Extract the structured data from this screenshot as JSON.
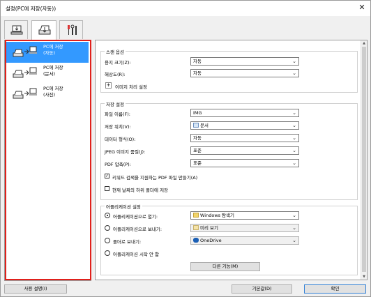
{
  "window": {
    "title": "설정(PC에 저장(자동))",
    "close": "✕"
  },
  "tabs": [
    {
      "name": "scan-tab"
    },
    {
      "name": "save-tab"
    },
    {
      "name": "tools-tab"
    }
  ],
  "left": {
    "items": [
      {
        "label1": "PC에 저장",
        "label2": "(자동)"
      },
      {
        "label1": "PC에 저장",
        "label2": "(문서)"
      },
      {
        "label1": "PC에 저장",
        "label2": "(사진)"
      }
    ]
  },
  "scan": {
    "title": "스캔 옵션",
    "paper_size_label": "용지 크기(Z):",
    "paper_size_value": "자동",
    "resolution_label": "해상도(R):",
    "resolution_value": "자동",
    "image_proc_label": "이미지 처리 설정",
    "plus": "+"
  },
  "save": {
    "title": "저장 설정",
    "filename_label": "파일 이름(F):",
    "filename_value": "IMG",
    "location_label": "저장 위치(V):",
    "location_value": "문서",
    "datafmt_label": "데이터 형식(O):",
    "datafmt_value": "자동",
    "jpeg_label": "JPEG 이미지 품질(J):",
    "jpeg_value": "표준",
    "pdf_label": "PDF 압축(P):",
    "pdf_value": "표준",
    "keyword_label": "키워드 검색을 지원하는 PDF 파일 만들기(A)",
    "keyword_check": "✓",
    "subfolder_label": "현재 날짜의 하위 폴더에 저장"
  },
  "app": {
    "title": "어플리케이션 설정",
    "open_label": "어플리케이션으로 열기:",
    "open_value": "Windows 탐색기",
    "send_label": "어플리케이션으로 보내기:",
    "send_value": "미리 보기",
    "folder_label": "폴더로 보내기:",
    "folder_value": "OneDrive",
    "none_label": "어플리케이션 시작 안 함",
    "more_label": "다른 기능(M)"
  },
  "footer": {
    "instructions": "사용 설명(I)",
    "defaults": "기본값(D)",
    "ok": "확인"
  },
  "colors": {
    "selection": "#3399ff",
    "highlight_border": "#e0201b"
  }
}
